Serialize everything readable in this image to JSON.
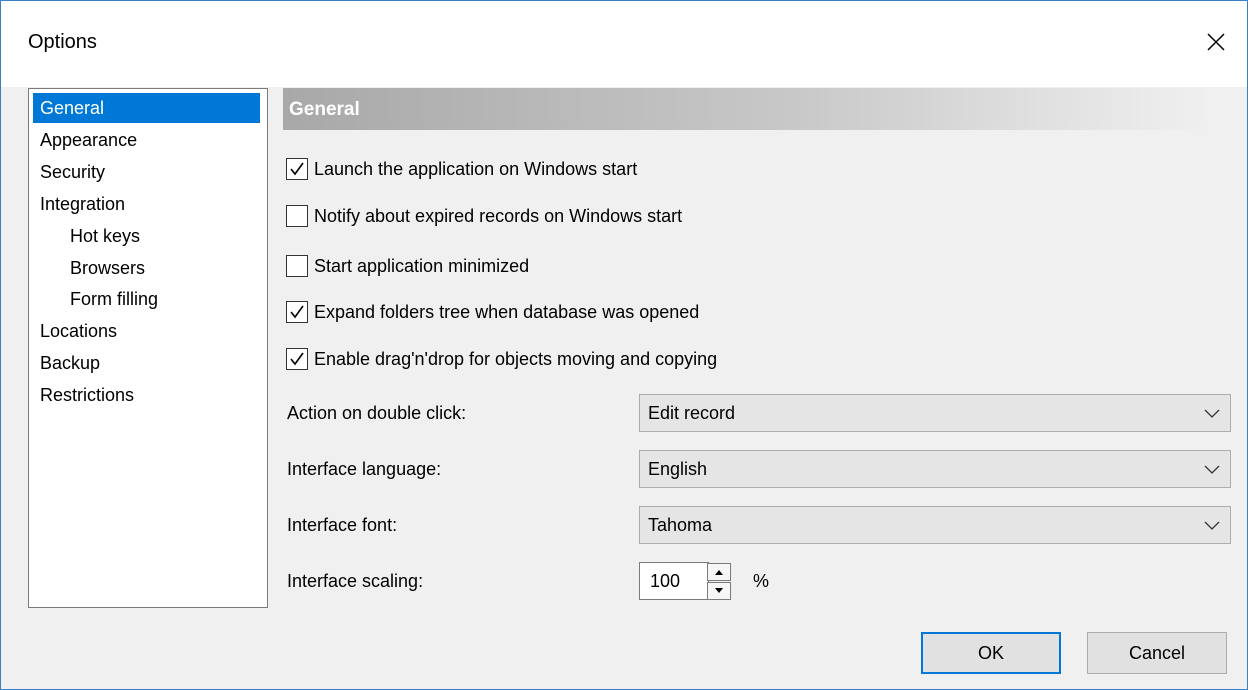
{
  "window": {
    "title": "Options"
  },
  "sidebar": {
    "items": [
      {
        "label": "General",
        "selected": true
      },
      {
        "label": "Appearance"
      },
      {
        "label": "Security"
      },
      {
        "label": "Integration"
      },
      {
        "label": "Hot keys",
        "sub": true
      },
      {
        "label": "Browsers",
        "sub": true
      },
      {
        "label": "Form filling",
        "sub": true
      },
      {
        "label": "Locations"
      },
      {
        "label": "Backup"
      },
      {
        "label": "Restrictions"
      }
    ]
  },
  "section": {
    "title": "General"
  },
  "options": [
    {
      "label": "Launch the application on Windows start",
      "checked": true
    },
    {
      "label": "Notify about expired records on Windows start",
      "checked": false
    },
    {
      "label": "Start application minimized",
      "checked": false
    },
    {
      "label": "Expand folders tree when database was opened",
      "checked": true
    },
    {
      "label": "Enable drag'n'drop for objects moving and copying",
      "checked": true
    }
  ],
  "fields": {
    "double_click": {
      "label": "Action on double click:",
      "value": "Edit record"
    },
    "language": {
      "label": "Interface language:",
      "value": "English"
    },
    "font": {
      "label": "Interface font:",
      "value": "Tahoma"
    },
    "scaling": {
      "label": "Interface scaling:",
      "value": "100",
      "unit": "%"
    }
  },
  "buttons": {
    "ok": "OK",
    "cancel": "Cancel"
  },
  "colors": {
    "accent": "#0078d7",
    "window_border": "#3c7fc8"
  }
}
